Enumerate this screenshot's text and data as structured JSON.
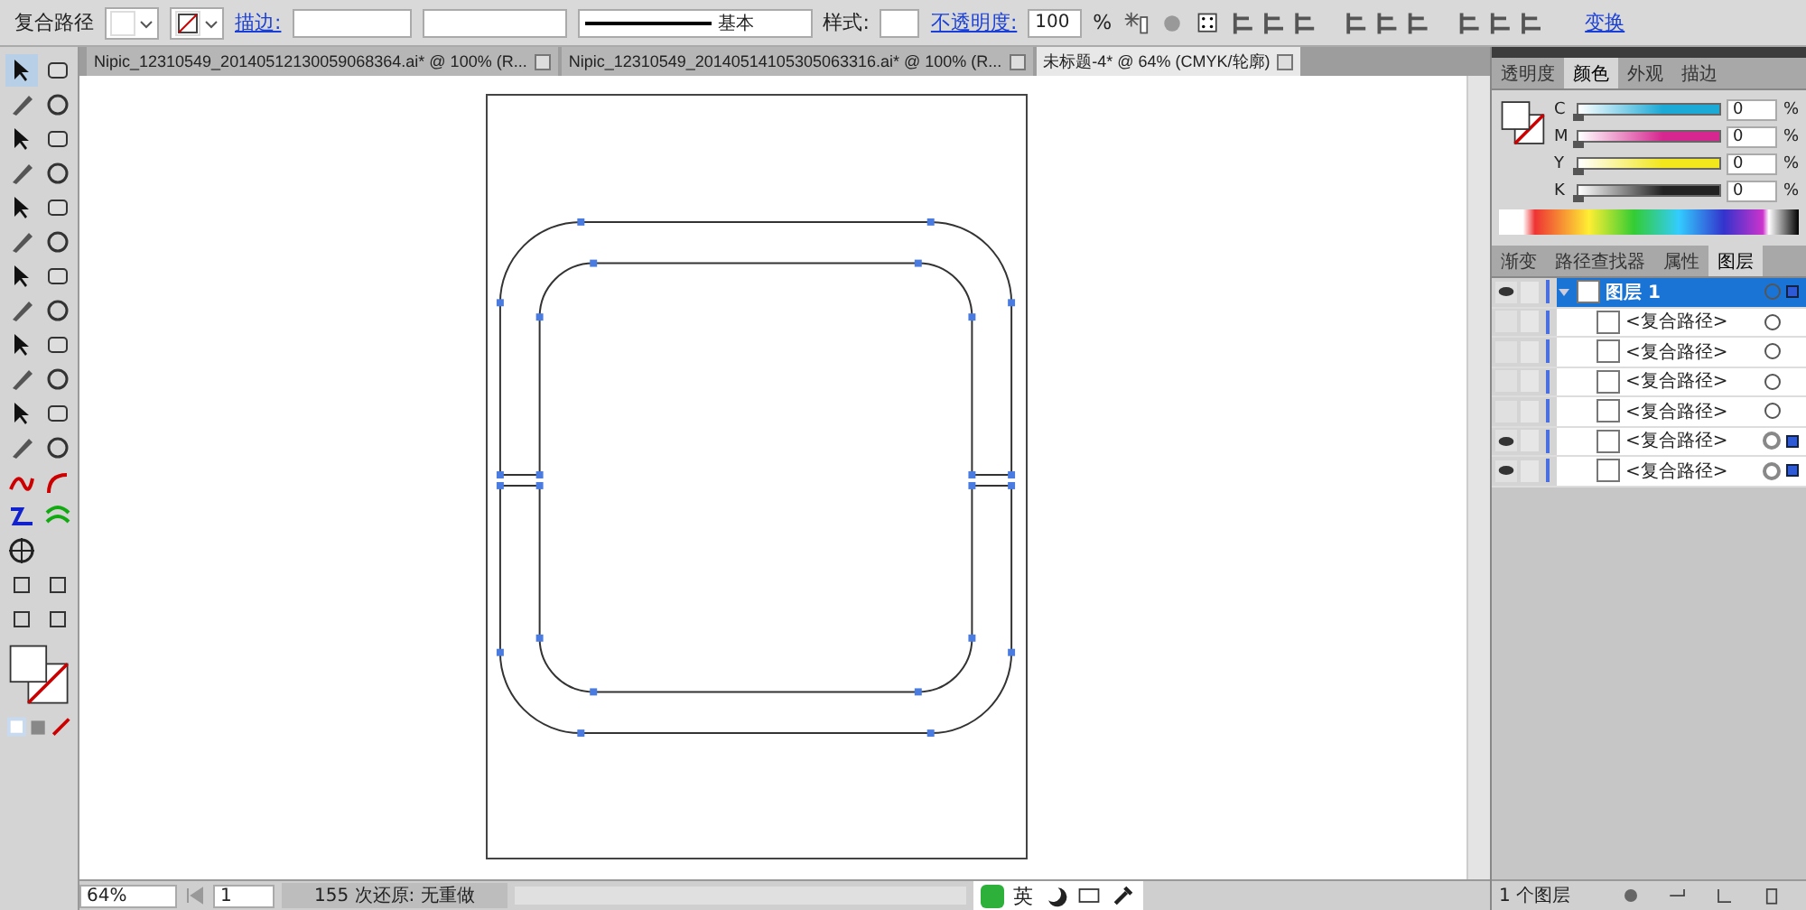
{
  "control_bar": {
    "object_type": "复合路径",
    "stroke_label": "描边:",
    "stroke_profile": "基本",
    "style_label": "样式:",
    "opacity_label": "不透明度:",
    "opacity": "100",
    "opacity_unit": "%",
    "transform_link": "变换"
  },
  "tabs": [
    {
      "label": "Nipic_12310549_20140512130059068364.ai* @ 100% (R...",
      "selected": false
    },
    {
      "label": "Nipic_12310549_20140514105305063316.ai* @ 100% (R...",
      "selected": false
    },
    {
      "label": "未标题-4* @ 64% (CMYK/轮廓)",
      "selected": true
    }
  ],
  "color_panel": {
    "tabs": [
      {
        "label": "透明度",
        "selected": false
      },
      {
        "label": "颜色",
        "selected": true
      },
      {
        "label": "外观",
        "selected": false
      },
      {
        "label": "描边",
        "selected": false
      }
    ],
    "channels": [
      {
        "label": "C",
        "value": "0",
        "level": 0,
        "color": "#1ba9d6"
      },
      {
        "label": "M",
        "value": "0",
        "level": 0,
        "color": "#d6268f"
      },
      {
        "label": "Y",
        "value": "0",
        "level": 0,
        "color": "#f2e61c"
      },
      {
        "label": "K",
        "value": "0",
        "level": 0,
        "color": "#222222"
      }
    ],
    "unit": "%"
  },
  "layers_panel": {
    "tabs": [
      {
        "label": "渐变",
        "selected": false
      },
      {
        "label": "路径查找器",
        "selected": false
      },
      {
        "label": "属性",
        "selected": false
      },
      {
        "label": "图层",
        "selected": true
      }
    ],
    "layers": [
      {
        "name": "图层 1",
        "visible": true,
        "expanded": true,
        "selected": true,
        "children": [
          {
            "name": "<复合路径>",
            "visible": false,
            "has_selection": false
          },
          {
            "name": "<复合路径>",
            "visible": false,
            "has_selection": false
          },
          {
            "name": "<复合路径>",
            "visible": false,
            "has_selection": false
          },
          {
            "name": "<复合路径>",
            "visible": false,
            "has_selection": false
          },
          {
            "name": "<复合路径>",
            "visible": true,
            "has_selection": true
          },
          {
            "name": "<复合路径>",
            "visible": true,
            "has_selection": true
          }
        ]
      }
    ],
    "footer": "1 个图层"
  },
  "status_bar": {
    "zoom": "64%",
    "page": "1",
    "status": "155 次还原: 无重做"
  },
  "ime_bar": {
    "mode": "英"
  }
}
